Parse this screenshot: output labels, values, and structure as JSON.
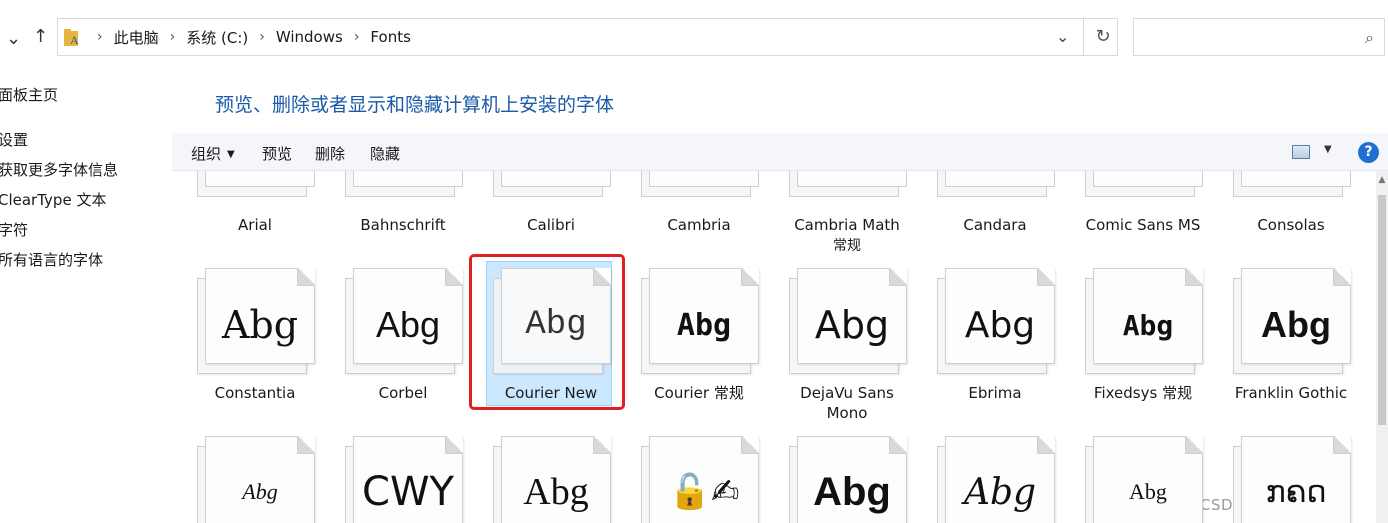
{
  "address": {
    "crumbs": [
      "此电脑",
      "系统 (C:)",
      "Windows",
      "Fonts"
    ],
    "dropdown_icon": "chevron-down-icon",
    "refresh_icon": "refresh-icon"
  },
  "search": {
    "placeholder": ""
  },
  "left_pane": {
    "items": [
      "面板主页",
      "设置",
      "获取更多字体信息",
      "ClearType 文本",
      "字符",
      "所有语言的字体"
    ]
  },
  "heading": "预览、删除或者显示和隐藏计算机上安装的字体",
  "toolbar": {
    "organize": "组织",
    "preview": "预览",
    "delete": "删除",
    "hide": "隐藏",
    "help": "?"
  },
  "fonts_row1": [
    {
      "name": "Arial",
      "sub": ""
    },
    {
      "name": "Bahnschrift",
      "sub": ""
    },
    {
      "name": "Calibri",
      "sub": ""
    },
    {
      "name": "Cambria",
      "sub": ""
    },
    {
      "name": "Cambria Math",
      "sub": "常规"
    },
    {
      "name": "Candara",
      "sub": ""
    },
    {
      "name": "Comic Sans MS",
      "sub": ""
    },
    {
      "name": "Consolas",
      "sub": ""
    }
  ],
  "fonts_row2": [
    {
      "name": "Constantia",
      "sub": "",
      "sample": "Abg"
    },
    {
      "name": "Corbel",
      "sub": "",
      "sample": "Abg"
    },
    {
      "name": "Courier New",
      "sub": "",
      "sample": "Abg"
    },
    {
      "name": "Courier 常规",
      "sub": "",
      "sample": "Abg"
    },
    {
      "name": "DejaVu Sans",
      "sub": "Mono",
      "sample": "Abg"
    },
    {
      "name": "Ebrima",
      "sub": "",
      "sample": "Abg"
    },
    {
      "name": "Fixedsys 常规",
      "sub": "",
      "sample": "Abg"
    },
    {
      "name": "Franklin Gothic",
      "sub": "",
      "sample": "Abg"
    }
  ],
  "fonts_row3": [
    {
      "sample": "Abg"
    },
    {
      "sample": "CWY"
    },
    {
      "sample": "Abg"
    },
    {
      "sample": "🔓✍"
    },
    {
      "sample": "Abg"
    },
    {
      "sample": "Abg"
    },
    {
      "sample": "Abg"
    },
    {
      "sample": "ກຄດ"
    }
  ],
  "selected_font": "Courier New",
  "watermark": "CSDN @水木、年華"
}
